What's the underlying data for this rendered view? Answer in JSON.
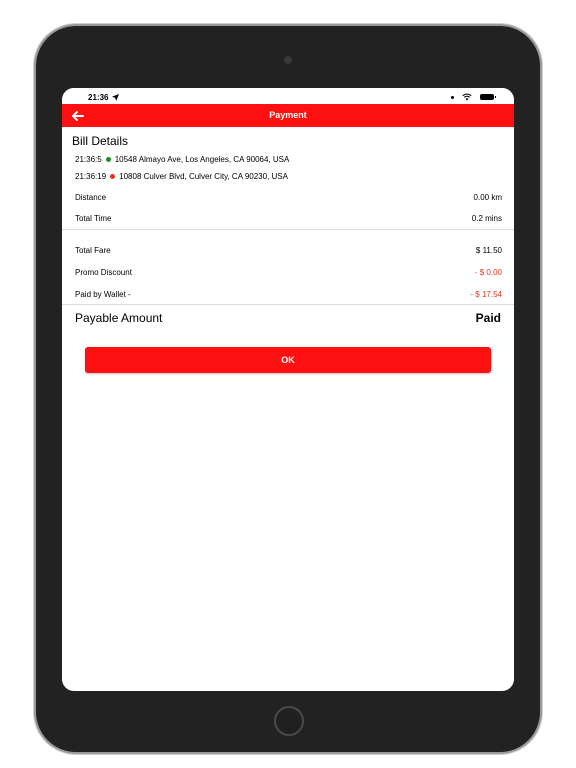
{
  "status_bar": {
    "time": "21:36"
  },
  "header": {
    "title": "Payment",
    "accent_color": "#ff1010"
  },
  "bill": {
    "section_title": "Bill Details",
    "pickup": {
      "time": "21:36:5",
      "address": "10548 Almayo Ave, Los Angeles, CA 90064, USA",
      "dot_color": "#1e8a2a"
    },
    "dropoff": {
      "time": "21:36:19",
      "address": "10808 Culver Blvd, Culver City, CA 90230, USA",
      "dot_color": "#e0361f"
    },
    "distance": {
      "label": "Distance",
      "value": "0.00 km"
    },
    "total_time": {
      "label": "Total Time",
      "value": "0.2 mins"
    },
    "total_fare": {
      "label": "Total Fare",
      "value": "$ 11.50"
    },
    "promo_discount": {
      "label": "Promo Discount",
      "value": "- $ 0.00"
    },
    "wallet": {
      "label": "Paid by Wallet -",
      "value": "- $ 17.54"
    },
    "payable": {
      "label": "Payable Amount",
      "value": "Paid"
    }
  },
  "actions": {
    "ok_label": "OK"
  }
}
